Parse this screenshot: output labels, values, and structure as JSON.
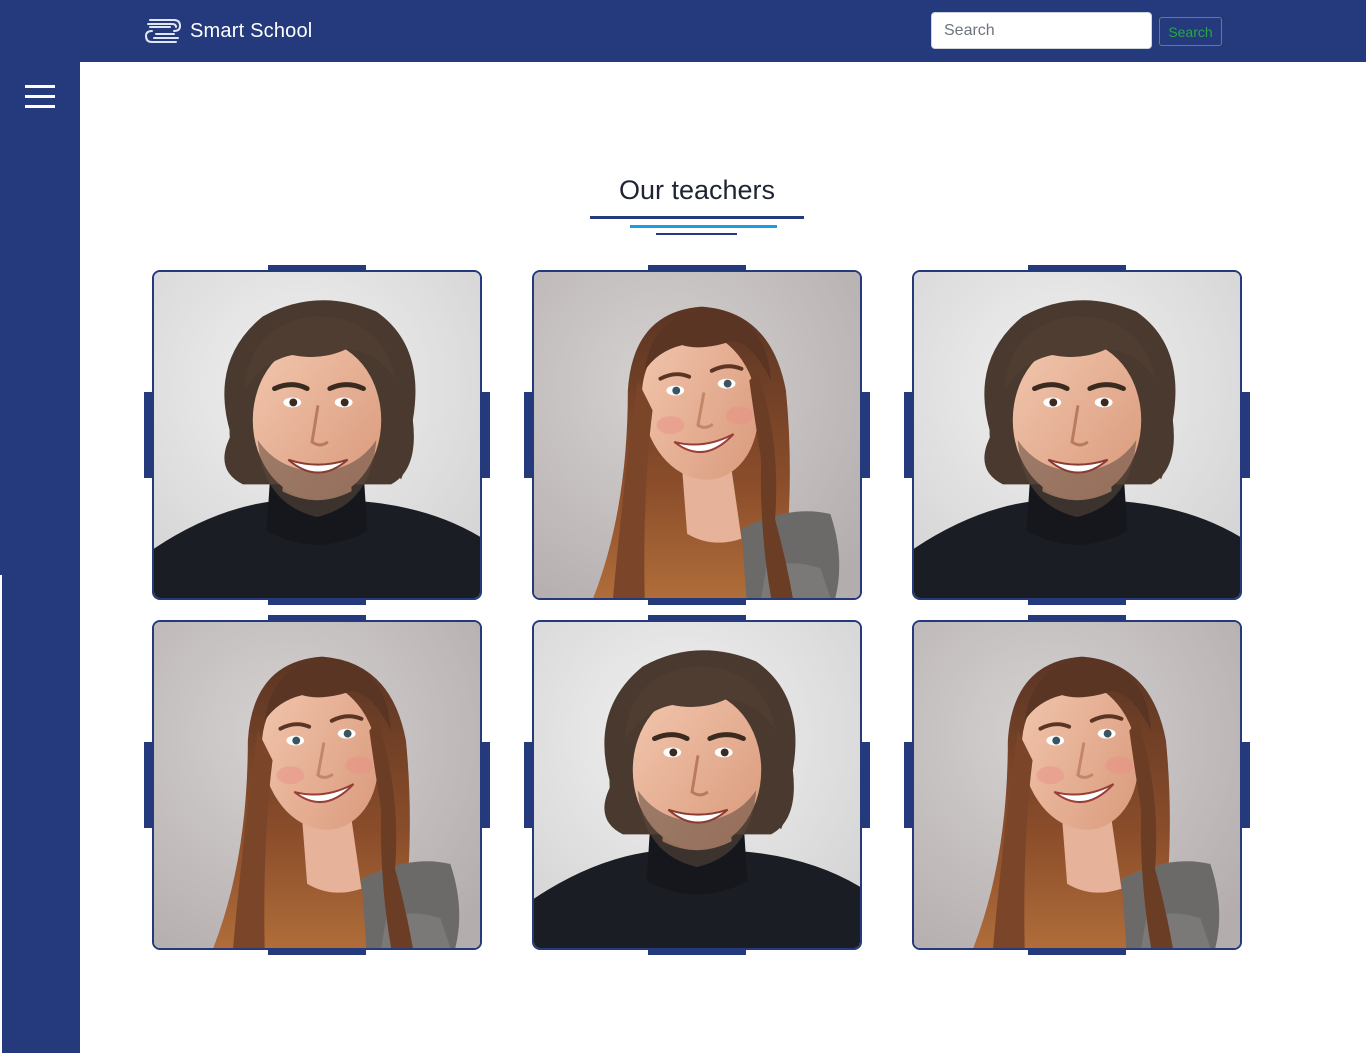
{
  "header": {
    "brand_name": "Smart School",
    "logo_icon": "smart-school-logo-icon",
    "search": {
      "placeholder": "Search",
      "value": "",
      "button_label": "Search"
    }
  },
  "sidebar": {
    "menu_icon": "hamburger-menu-icon"
  },
  "main": {
    "title": "Our teachers",
    "teachers": [
      {
        "photo": "male-teacher"
      },
      {
        "photo": "female-teacher"
      },
      {
        "photo": "male-teacher"
      },
      {
        "photo": "female-teacher"
      },
      {
        "photo": "male-teacher"
      },
      {
        "photo": "female-teacher"
      }
    ]
  },
  "colors": {
    "brand": "#243a7c",
    "accent": "#1a9fdc",
    "search_button": "#28a745",
    "background": "#ffffff"
  }
}
